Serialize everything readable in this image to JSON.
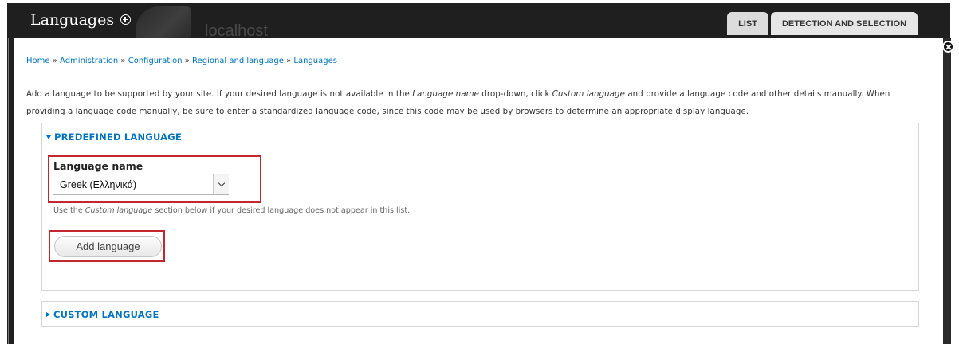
{
  "header": {
    "title": "Languages",
    "host": "localhost",
    "tabs": [
      {
        "label": "LIST"
      },
      {
        "label": "DETECTION AND SELECTION"
      }
    ]
  },
  "breadcrumb": {
    "items": [
      "Home",
      "Administration",
      "Configuration",
      "Regional and language",
      "Languages"
    ],
    "separator": "»"
  },
  "help": {
    "part1": "Add a language to be supported by your site. If your desired language is not available in the ",
    "em1": "Language name",
    "part2": " drop-down, click ",
    "em2": "Custom language",
    "part3": " and provide a language code and other details manually. When providing a language code manually, be sure to enter a standardized language code, since this code may be used by browsers to determine an appropriate display language."
  },
  "predefined": {
    "legend": "PREDEFINED LANGUAGE",
    "field_label": "Language name",
    "selected": "Greek (Ελληνικά)",
    "desc_before": "Use the ",
    "desc_em": "Custom language",
    "desc_after": " section below if your desired language does not appear in this list.",
    "button": "Add language"
  },
  "custom": {
    "legend": "CUSTOM LANGUAGE"
  },
  "colors": {
    "link": "#0074bd",
    "highlight": "#c1272d",
    "header_bg": "#1f1f1f"
  }
}
